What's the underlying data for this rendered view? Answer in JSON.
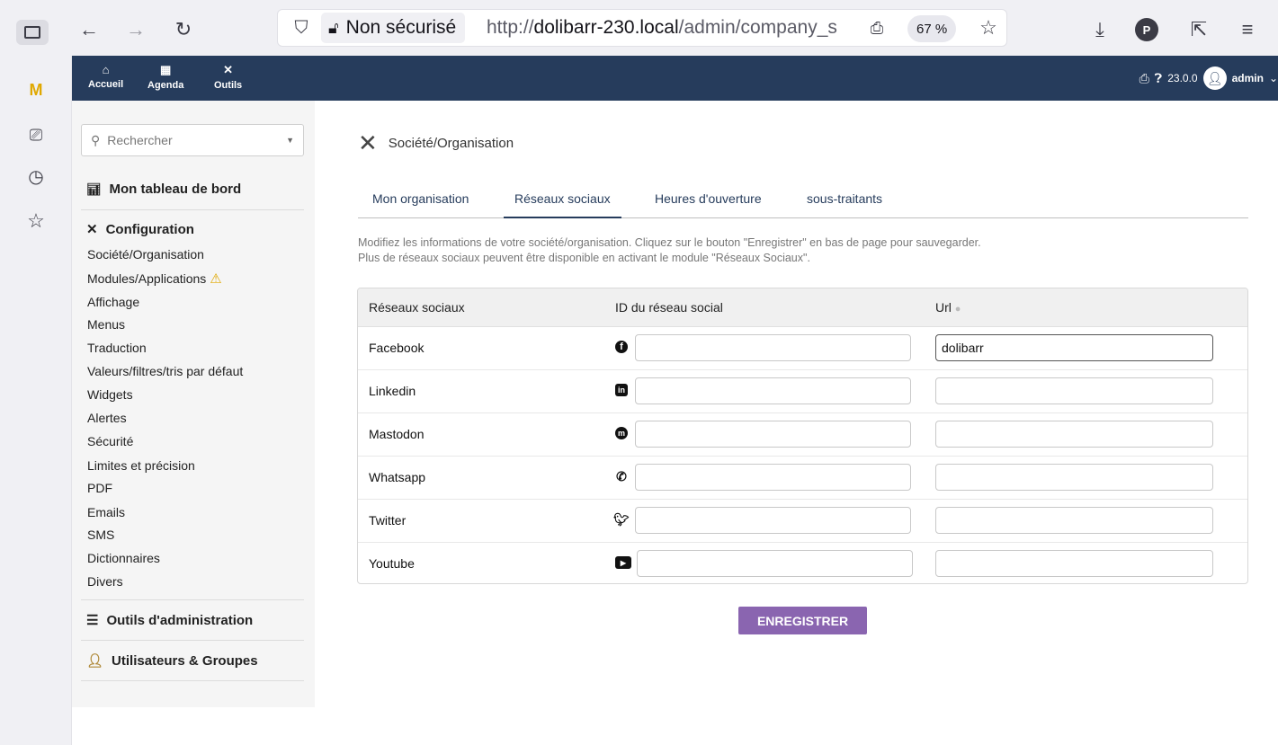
{
  "browser": {
    "security_label": "Non sécurisé",
    "url_prefix": "http://",
    "url_host": "dolibarr-230.local",
    "url_path": "/admin/company_s",
    "zoom": "67 %"
  },
  "topnav": {
    "items": [
      {
        "label": "Accueil",
        "icon": "home-icon"
      },
      {
        "label": "Agenda",
        "icon": "calendar-icon"
      },
      {
        "label": "Outils",
        "icon": "tools-icon"
      }
    ],
    "version": "23.0.0",
    "user": "admin"
  },
  "leftmenu": {
    "search_placeholder": "Rechercher",
    "dashboard_label": "Mon tableau de bord",
    "config_label": "Configuration",
    "config_items": [
      "Société/Organisation",
      "Modules/Applications",
      "Affichage",
      "Menus",
      "Traduction",
      "Valeurs/filtres/tris par défaut",
      "Widgets",
      "Alertes",
      "Sécurité",
      "Limites et précision",
      "PDF",
      "Emails",
      "SMS",
      "Dictionnaires",
      "Divers"
    ],
    "admin_tools_label": "Outils d'administration",
    "users_groups_label": "Utilisateurs & Groupes"
  },
  "main": {
    "title": "Société/Organisation",
    "tabs": [
      {
        "label": "Mon organisation",
        "active": false
      },
      {
        "label": "Réseaux sociaux",
        "active": true
      },
      {
        "label": "Heures d'ouverture",
        "active": false
      },
      {
        "label": "sous-traitants",
        "active": false
      }
    ],
    "intro_line1": "Modifiez les informations de votre société/organisation. Cliquez sur le bouton \"Enregistrer\" en bas de page pour sauvegarder.",
    "intro_line2": "Plus de réseaux sociaux peuvent être disponible en activant le module \"Réseaux Sociaux\".",
    "table": {
      "col1": "Réseaux sociaux",
      "col2": "ID du réseau social",
      "col3": "Url",
      "rows": [
        {
          "name": "Facebook",
          "icon": "facebook-icon",
          "id_value": "",
          "url_value": "dolibarr"
        },
        {
          "name": "Linkedin",
          "icon": "linkedin-icon",
          "id_value": "",
          "url_value": ""
        },
        {
          "name": "Mastodon",
          "icon": "mastodon-icon",
          "id_value": "",
          "url_value": ""
        },
        {
          "name": "Whatsapp",
          "icon": "whatsapp-icon",
          "id_value": "",
          "url_value": ""
        },
        {
          "name": "Twitter",
          "icon": "twitter-icon",
          "id_value": "",
          "url_value": ""
        },
        {
          "name": "Youtube",
          "icon": "youtube-icon",
          "id_value": "",
          "url_value": ""
        }
      ]
    },
    "save_label": "ENREGISTRER"
  },
  "colors": {
    "nav_bg": "#263c5c",
    "accent_button": "#8a65b0",
    "warning": "#e0a800"
  }
}
